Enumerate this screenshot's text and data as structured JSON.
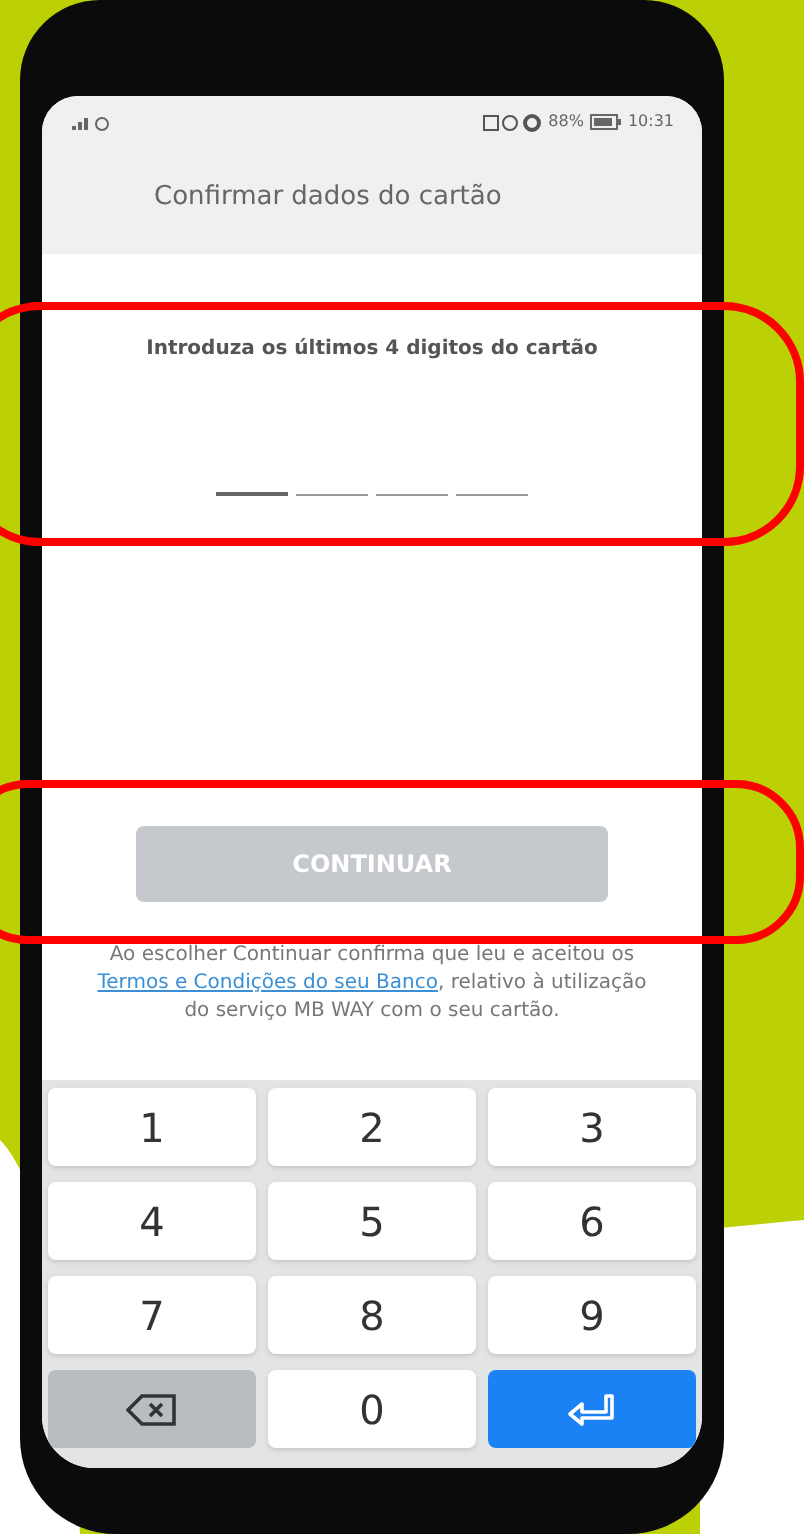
{
  "status_bar": {
    "battery": "88%",
    "time": "10:31"
  },
  "header": {
    "title": "Confirmar dados do cartão"
  },
  "prompt": "Introduza os últimos 4 digitos do cartão",
  "digit_fields": [
    {
      "focused": true
    },
    {
      "focused": false
    },
    {
      "focused": false
    },
    {
      "focused": false
    }
  ],
  "continue_button": {
    "label": "CONTINUAR",
    "disabled": true
  },
  "terms": {
    "before": "Ao escolher Continuar confirma que leu e aceitou os ",
    "link": "Termos e Condições do seu Banco",
    "after": ", relativo à utilização do serviço MB WAY com o seu cartão."
  },
  "keypad": [
    {
      "kind": "digit",
      "label": "1"
    },
    {
      "kind": "digit",
      "label": "2"
    },
    {
      "kind": "digit",
      "label": "3"
    },
    {
      "kind": "digit",
      "label": "4"
    },
    {
      "kind": "digit",
      "label": "5"
    },
    {
      "kind": "digit",
      "label": "6"
    },
    {
      "kind": "digit",
      "label": "7"
    },
    {
      "kind": "digit",
      "label": "8"
    },
    {
      "kind": "digit",
      "label": "9"
    },
    {
      "kind": "delete"
    },
    {
      "kind": "digit",
      "label": "0"
    },
    {
      "kind": "enter"
    }
  ]
}
